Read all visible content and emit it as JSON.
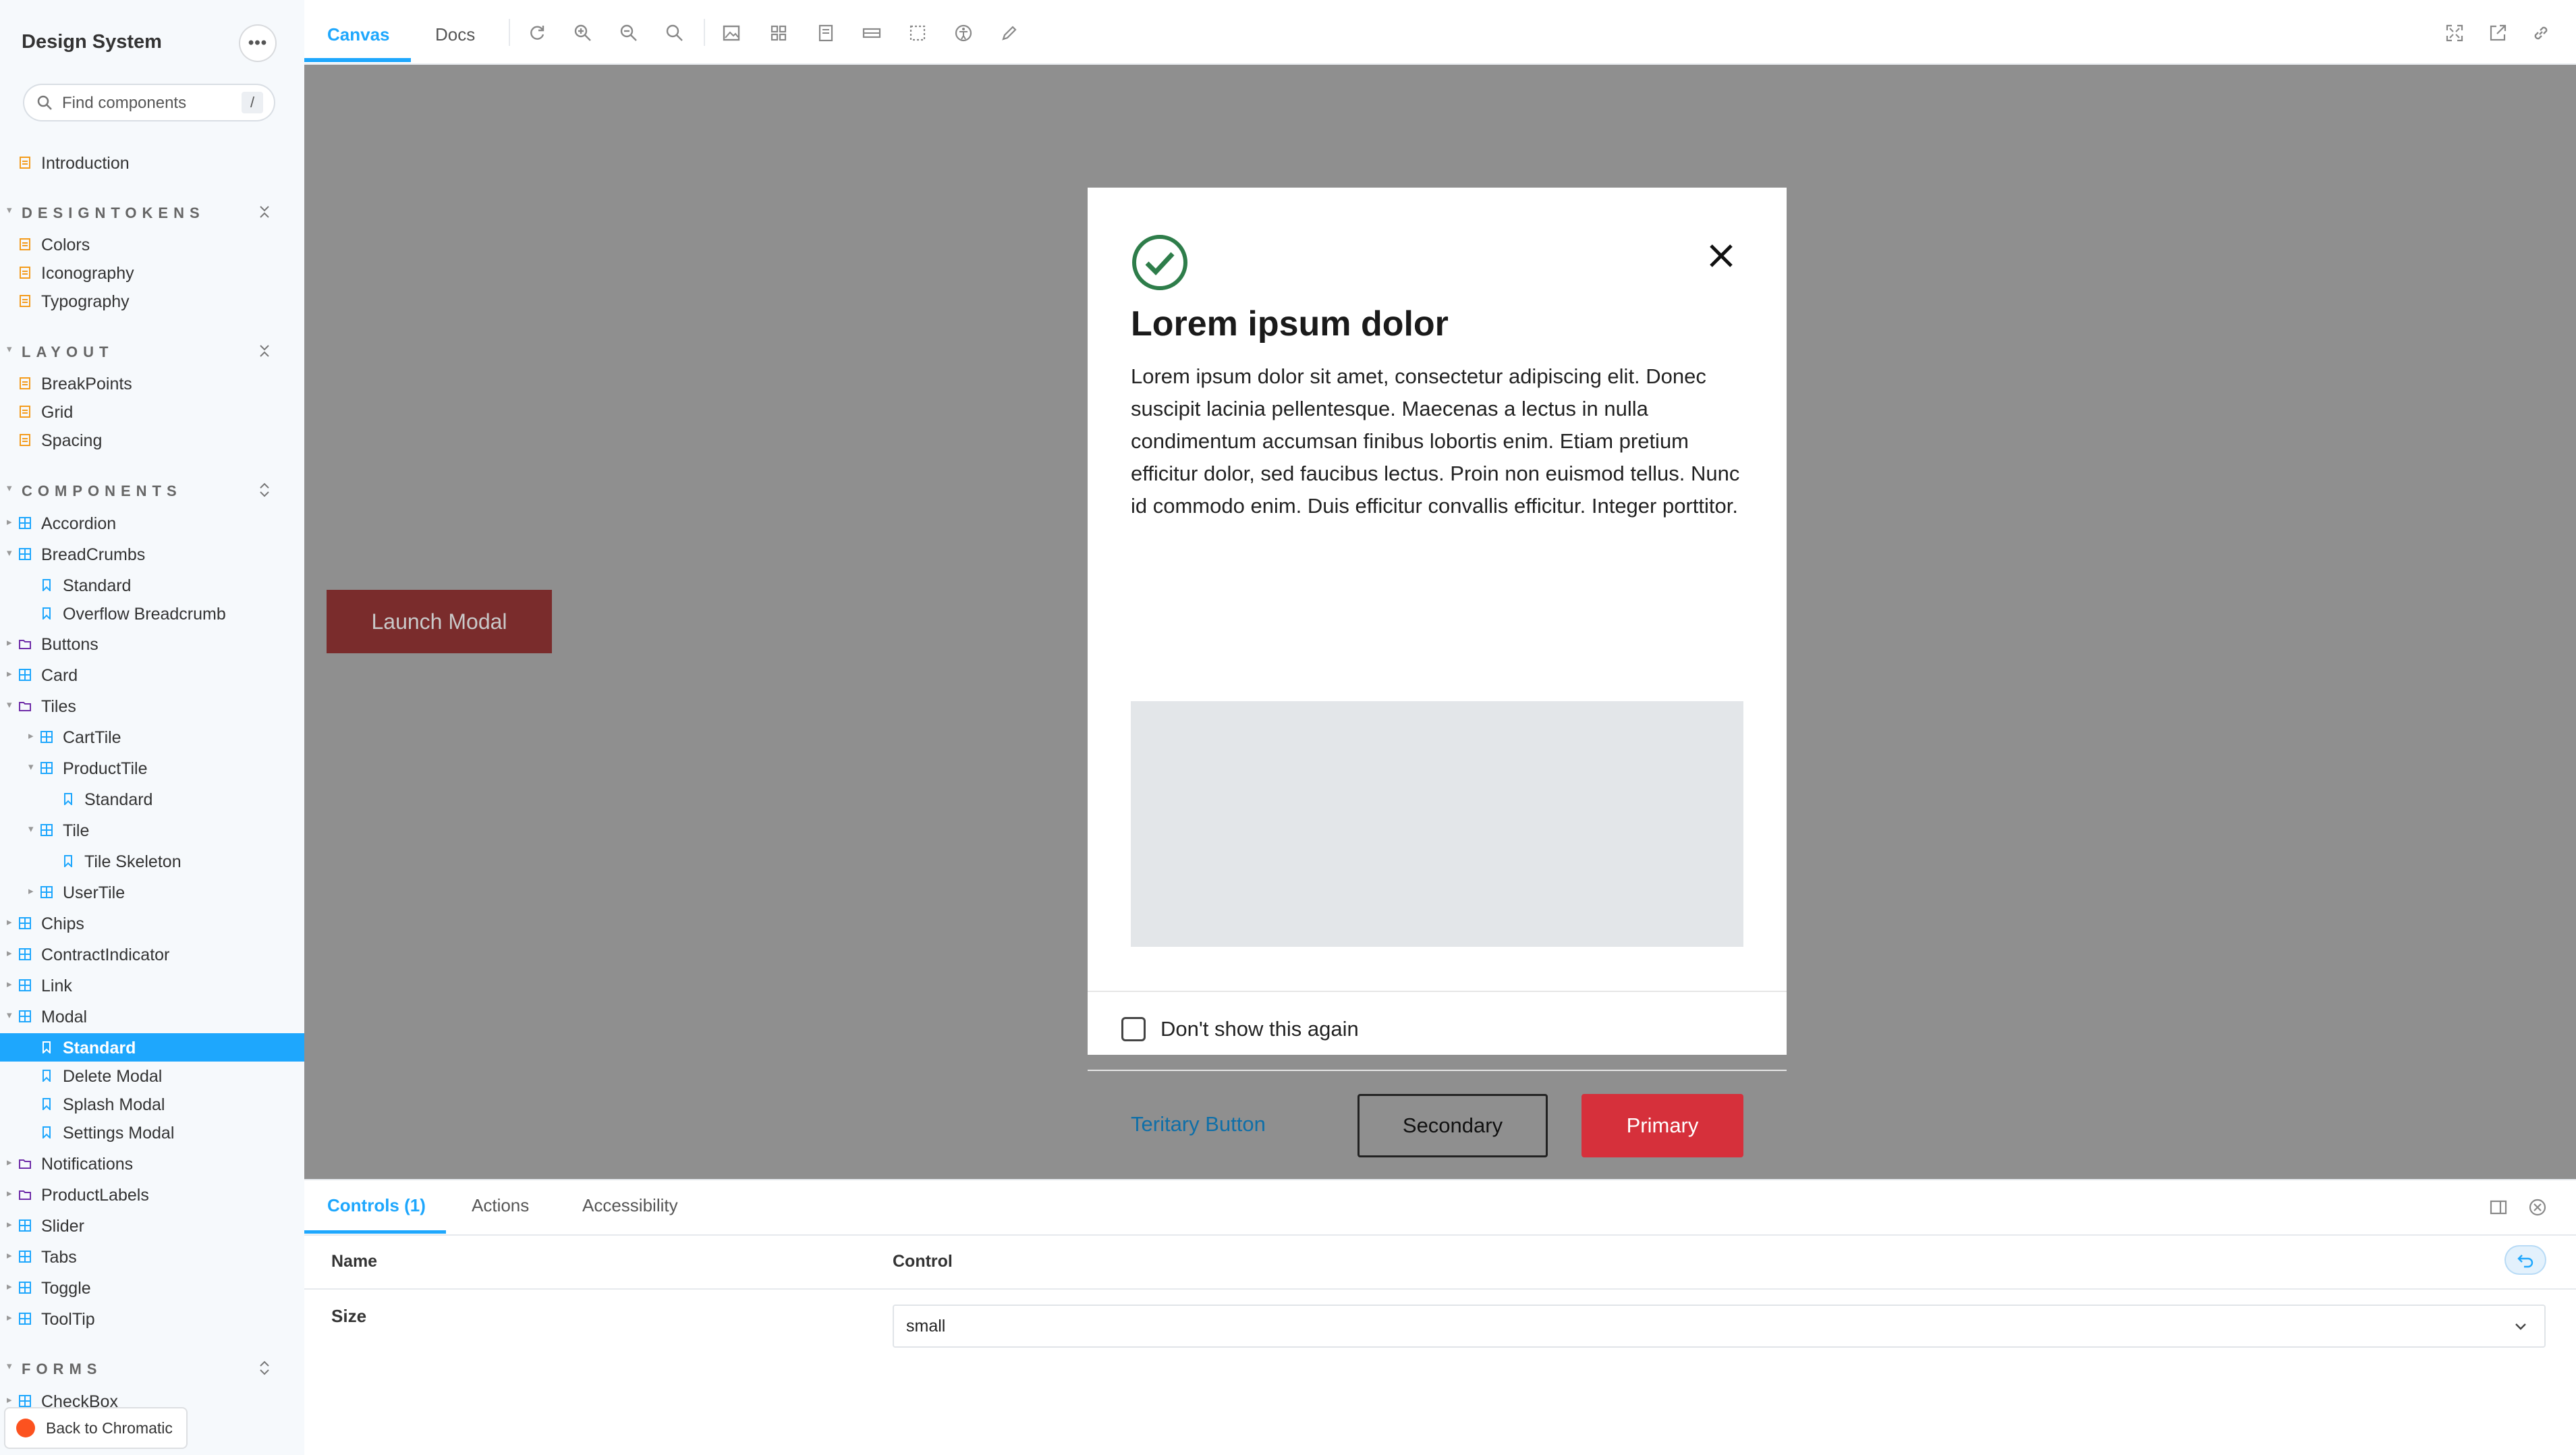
{
  "sidebar": {
    "title": "Design System",
    "more_label": "•••",
    "search": {
      "placeholder": "Find components",
      "shortcut": "/"
    },
    "intro": "Introduction",
    "sections": {
      "designtokens": "DESIGNTOKENS",
      "layout": "LAYOUT",
      "components": "COMPONENTS",
      "forms": "FORMS"
    },
    "designtokens": [
      "Colors",
      "Iconography",
      "Typography"
    ],
    "layout": [
      "BreakPoints",
      "Grid",
      "Spacing"
    ],
    "components": {
      "accordion": "Accordion",
      "breadcrumbs": "BreadCrumbs",
      "bc_standard": "Standard",
      "bc_overflow": "Overflow Breadcrumb",
      "buttons": "Buttons",
      "card": "Card",
      "tiles": "Tiles",
      "carttile": "CartTile",
      "producttile": "ProductTile",
      "pt_standard": "Standard",
      "tile": "Tile",
      "tile_skeleton": "Tile Skeleton",
      "usertile": "UserTile",
      "chips": "Chips",
      "contract": "ContractIndicator",
      "link": "Link",
      "modal": "Modal",
      "modal_standard": "Standard",
      "modal_delete": "Delete Modal",
      "modal_splash": "Splash Modal",
      "modal_settings": "Settings Modal",
      "notifications": "Notifications",
      "productlabels": "ProductLabels",
      "slider": "Slider",
      "tabs": "Tabs",
      "toggle": "Toggle",
      "tooltip": "ToolTip"
    },
    "forms": {
      "checkbox": "CheckBox"
    },
    "back_button": "Back to Chromatic"
  },
  "toolbar": {
    "tabs": [
      "Canvas",
      "Docs"
    ],
    "active_tab": "Canvas",
    "tools": [
      "reload-icon",
      "zoom-in-icon",
      "zoom-out-icon",
      "zoom-reset-icon",
      "background-icon",
      "grid-icon",
      "viewport-icon",
      "measure-icon",
      "outline-icon",
      "accessibility-icon",
      "pencil-icon"
    ],
    "right_tools": [
      "fullscreen-icon",
      "share-icon",
      "link-icon"
    ]
  },
  "canvas": {
    "launch_button": "Launch Modal",
    "modal": {
      "title": "Lorem ipsum dolor",
      "body": "Lorem ipsum dolor sit amet, consectetur adipiscing elit. Donec suscipit lacinia pellentesque. Maecenas a lectus in nulla condimentum accumsan finibus lobortis enim. Etiam pretium efficitur dolor, sed faucibus lectus. Proin non euismod tellus. Nunc id commodo enim. Duis efficitur convallis efficitur. Integer porttitor.",
      "checkbox_label": "Don't show this again",
      "checkbox_checked": false,
      "tertiary_button": "Teritary Button",
      "secondary_button": "Secondary",
      "primary_button": "Primary"
    }
  },
  "panel": {
    "tabs": [
      "Controls (1)",
      "Actions",
      "Accessibility"
    ],
    "active_tab": "Controls (1)",
    "columns": {
      "name": "Name",
      "control": "Control"
    },
    "rows": [
      {
        "name": "Size",
        "value": "small"
      }
    ]
  },
  "colors": {
    "accent": "#1ea7fd",
    "primary_button": "#d6303b",
    "canvas_bg": "#8f8f8f",
    "success_check": "#2e7d4a"
  }
}
